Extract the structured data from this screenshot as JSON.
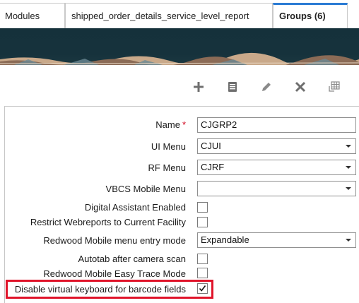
{
  "tabs": [
    {
      "label": "Modules",
      "active": false
    },
    {
      "label": "shipped_order_details_service_level_report",
      "active": false
    },
    {
      "label": "Groups (6)",
      "active": true
    }
  ],
  "toolbar": {
    "buttons": [
      {
        "name": "add",
        "icon": "plus-icon"
      },
      {
        "name": "details",
        "icon": "document-icon"
      },
      {
        "name": "edit",
        "icon": "pencil-icon"
      },
      {
        "name": "delete",
        "icon": "x-icon"
      },
      {
        "name": "grid",
        "icon": "grid-icon"
      }
    ]
  },
  "form": {
    "name": {
      "label": "Name",
      "required_mark": "*",
      "value": "CJGRP2"
    },
    "ui_menu": {
      "label": "UI Menu",
      "value": "CJUI"
    },
    "rf_menu": {
      "label": "RF Menu",
      "value": "CJRF"
    },
    "vbcs_menu": {
      "label": "VBCS Mobile Menu",
      "value": ""
    },
    "digital_assistant": {
      "label": "Digital Assistant Enabled",
      "checked": false
    },
    "restrict_webreports": {
      "label": "Restrict Webreports to Current Facility",
      "checked": false
    },
    "redwood_entry_mode": {
      "label": "Redwood Mobile menu entry mode",
      "value": "Expandable"
    },
    "autotab": {
      "label": "Autotab after camera scan",
      "checked": false
    },
    "easy_trace": {
      "label": "Redwood Mobile Easy Trace Mode",
      "checked": false
    },
    "disable_keyboard": {
      "label": "Disable virtual keyboard for barcode fields",
      "checked": true
    }
  },
  "colors": {
    "accent_tab": "#2a7bd4",
    "highlight": "#e0142a",
    "banner": "#15313b",
    "required": "#d0021b"
  }
}
